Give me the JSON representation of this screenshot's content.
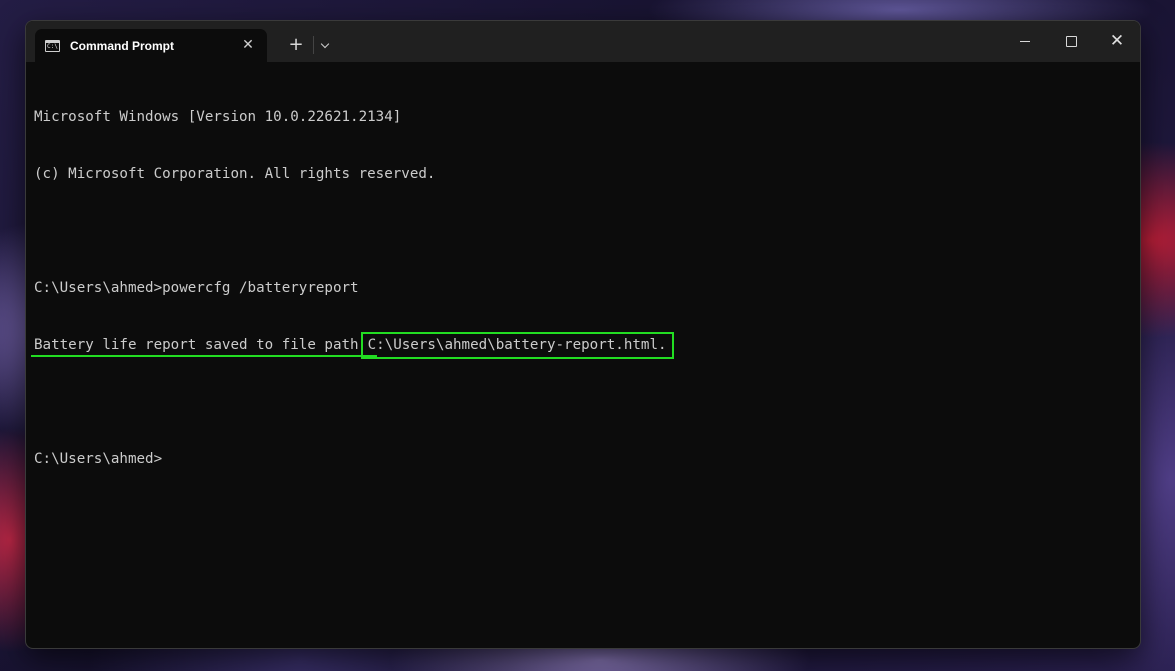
{
  "window": {
    "tab_title": "Command Prompt",
    "tab_icon": "C:\\",
    "new_tab_label": "+",
    "tab_close_label": "✕",
    "close_label": "✕"
  },
  "console": {
    "lines": [
      "Microsoft Windows [Version 10.0.22621.2134]",
      "(c) Microsoft Corporation. All rights reserved.",
      "",
      "C:\\Users\\ahmed>powercfg /batteryreport"
    ],
    "report_message": "Battery life report saved to file path",
    "report_path": "C:\\Users\\ahmed\\battery-report.html.",
    "prompt": "C:\\Users\\ahmed>"
  },
  "colors": {
    "terminal_bg": "#0c0c0c",
    "terminal_text": "#cccccc",
    "highlight": "#22dd22",
    "titlebar": "#202020"
  }
}
